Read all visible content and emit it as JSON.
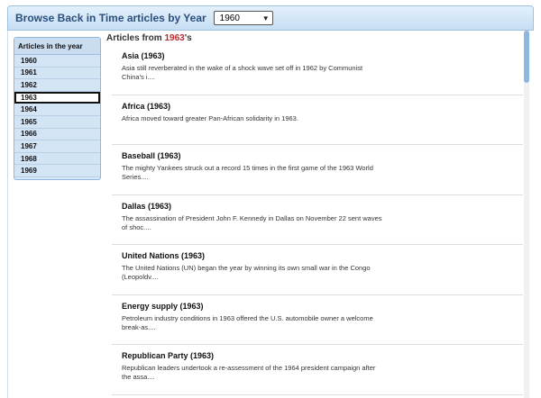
{
  "header": {
    "title": "Browse Back in Time articles by Year",
    "year_select": {
      "value": "1960"
    }
  },
  "sidebar": {
    "heading": "Articles in the year",
    "items": [
      "1960",
      "1961",
      "1962",
      "1963",
      "1964",
      "1965",
      "1966",
      "1967",
      "1968",
      "1969"
    ],
    "selected": "1963"
  },
  "main": {
    "heading_prefix": "Articles from ",
    "heading_year": "1963",
    "heading_suffix": "'s",
    "articles": [
      {
        "title": "Asia (1963)",
        "summary": "Asia still reverberated in the wake of a shock wave set off in 1962 by Communist China's i...."
      },
      {
        "title": "Africa (1963)",
        "summary": "Africa moved toward greater Pan-African solidarity in 1963."
      },
      {
        "title": "Baseball (1963)",
        "summary": "The mighty Yankees struck out a record 15 times in the first game of the 1963 World Series...."
      },
      {
        "title": "Dallas (1963)",
        "summary": "The assassination of President John F. Kennedy in Dallas on November 22 sent waves of shoc...."
      },
      {
        "title": "United Nations (1963)",
        "summary": "The United Nations (UN) began the year by winning its own small war in the Congo (Leopoldv...."
      },
      {
        "title": "Energy supply (1963)",
        "summary": "Petroleum industry conditions in 1963 offered the U.S. automobile owner a welcome break-as...."
      },
      {
        "title": "Republican Party (1963)",
        "summary": "Republican leaders undertook a re-assessment of the 1964 president campaign after the assa...."
      }
    ]
  },
  "colors": {
    "header_text": "#2b4f7d",
    "year_highlight": "#c0262d",
    "sidebar_bg": "#d8e7f6",
    "scroll_thumb": "#8eb7df"
  }
}
